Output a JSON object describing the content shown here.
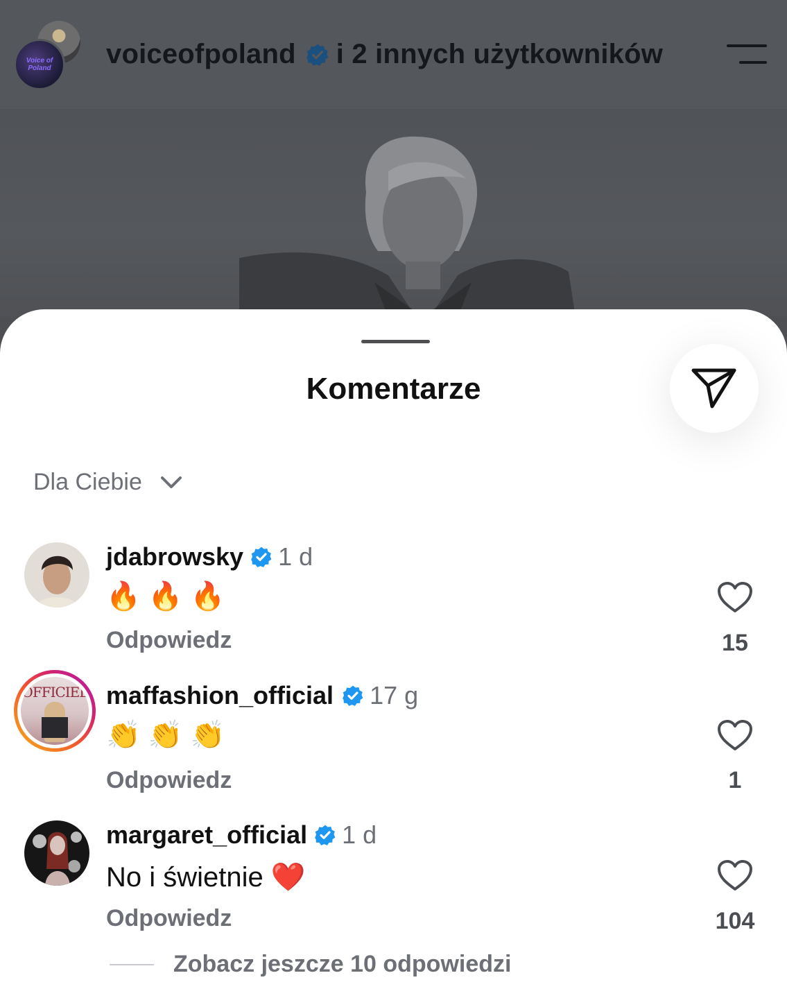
{
  "header": {
    "username": "voiceofpoland",
    "others_text": "i 2 innych użytkowników",
    "avatar_text": "Voice of Poland"
  },
  "sheet": {
    "title": "Komentarze",
    "sort_label": "Dla Ciebie"
  },
  "comments": [
    {
      "username": "jdabrowsky",
      "time": "1 d",
      "text": "🔥 🔥 🔥",
      "reply_label": "Odpowiedz",
      "likes": "15",
      "verified": true
    },
    {
      "username": "maffashion_official",
      "time": "17 g",
      "text": "👏 👏 👏",
      "reply_label": "Odpowiedz",
      "likes": "1",
      "verified": true,
      "avatar_text": "OFFICIEL"
    },
    {
      "username": "margaret_official",
      "time": "1 d",
      "text": "No i świetnie ❤️",
      "reply_label": "Odpowiedz",
      "likes": "104",
      "verified": true
    }
  ],
  "more_replies_label": "Zobacz jeszcze 10 odpowiedzi",
  "colors": {
    "verified_blue": "#1d97f0",
    "muted_text": "#6c6f75",
    "story_ring": [
      "#f7b21a",
      "#f2562e",
      "#d3246d",
      "#b01bb0"
    ]
  },
  "icons": [
    "verified-badge-icon",
    "menu-icon",
    "share-send-icon",
    "chevron-down-icon",
    "heart-icon"
  ]
}
